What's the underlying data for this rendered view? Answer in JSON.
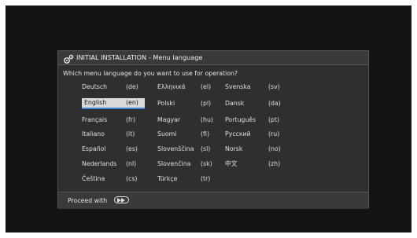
{
  "dialog": {
    "title": "INITIAL INSTALLATION - Menu language",
    "icon": "settings-gears-icon",
    "question": "Which menu language do you want to use for operation?",
    "footer": {
      "proceed_label": "Proceed with",
      "proceed_icon": "fast-forward-button-icon"
    }
  },
  "languages": [
    {
      "name": "Deutsch",
      "code": "(de)"
    },
    {
      "name": "English",
      "code": "(en)",
      "selected": true
    },
    {
      "name": "Français",
      "code": "(fr)"
    },
    {
      "name": "Italiano",
      "code": "(it)"
    },
    {
      "name": "Español",
      "code": "(es)"
    },
    {
      "name": "Nederlands",
      "code": "(nl)"
    },
    {
      "name": "Čeština",
      "code": "(cs)"
    },
    {
      "name": "Ελληνικά",
      "code": "(el)"
    },
    {
      "name": "Polski",
      "code": "(pl)"
    },
    {
      "name": "Magyar",
      "code": "(hu)"
    },
    {
      "name": "Suomi",
      "code": "(fi)"
    },
    {
      "name": "Slovenščina",
      "code": "(sl)"
    },
    {
      "name": "Slovenčina",
      "code": "(sk)"
    },
    {
      "name": "Türkçe",
      "code": "(tr)"
    },
    {
      "name": "Svenska",
      "code": "(sv)"
    },
    {
      "name": "Dansk",
      "code": "(da)"
    },
    {
      "name": "Português",
      "code": "(pt)"
    },
    {
      "name": "Русский",
      "code": "(ru)"
    },
    {
      "name": "Norsk",
      "code": "(no)"
    },
    {
      "name": "中文",
      "code": "(zh)"
    }
  ]
}
